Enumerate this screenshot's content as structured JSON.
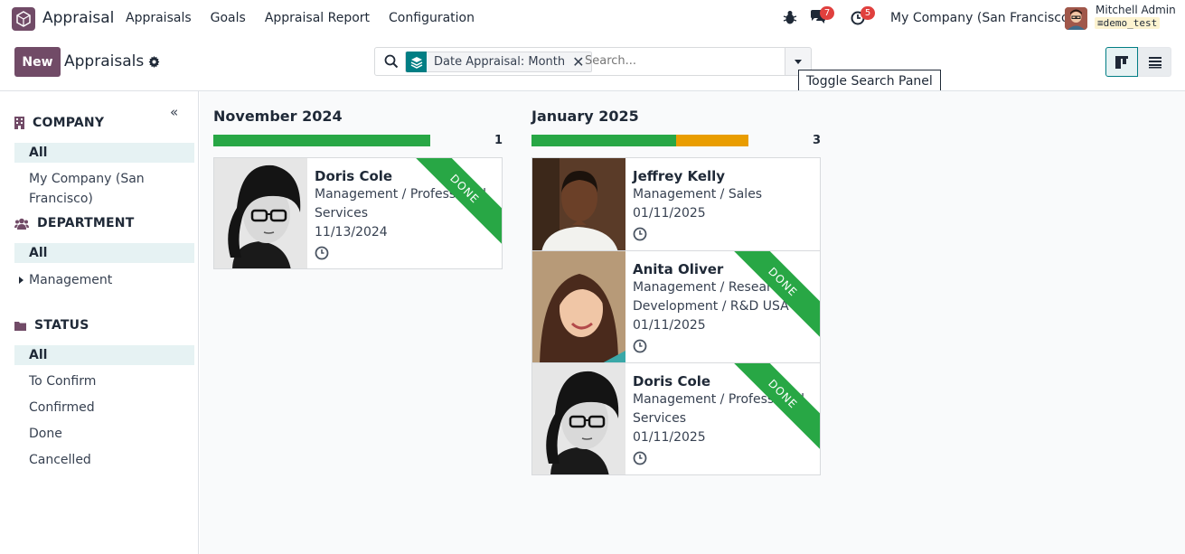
{
  "navbar": {
    "app_name": "Appraisal",
    "menu": [
      "Appraisals",
      "Goals",
      "Appraisal Report",
      "Configuration"
    ],
    "chat_badge": "7",
    "activity_badge": "5",
    "company": "My Company (San Francisco)",
    "user_name": "Mitchell Admin",
    "database": "demo_test"
  },
  "control_panel": {
    "new_label": "New",
    "breadcrumb": "Appraisals",
    "facet_label": "Date Appraisal: Month",
    "search_placeholder": "Search...",
    "tooltip": "Toggle Search Panel"
  },
  "sidepanel": {
    "sections": [
      {
        "title": "COMPANY",
        "icon": "building-icon",
        "items": [
          "All",
          "My Company (San Francisco)"
        ]
      },
      {
        "title": "DEPARTMENT",
        "icon": "users-icon",
        "items": [
          "All",
          "Management"
        ]
      },
      {
        "title": "STATUS",
        "icon": "folder-icon",
        "items": [
          "All",
          "To Confirm",
          "Confirmed",
          "Done",
          "Cancelled"
        ]
      }
    ]
  },
  "kanban": {
    "columns": [
      {
        "title": "November 2024",
        "count": "1",
        "progress": {
          "green": 1.0,
          "orange": 0.0
        },
        "cards": [
          {
            "name": "Doris Cole",
            "lines": [
              "Management / Professional",
              "Services"
            ],
            "date": "11/13/2024",
            "ribbon": "DONE",
            "photo": "woman-beanie-glasses"
          }
        ]
      },
      {
        "title": "January 2025",
        "count": "3",
        "progress": {
          "green": 0.667,
          "orange": 0.333
        },
        "cards": [
          {
            "name": "Jeffrey Kelly",
            "lines": [
              "Management / Sales"
            ],
            "date": "01/11/2025",
            "ribbon": "",
            "photo": "man-white-shirt"
          },
          {
            "name": "Anita Oliver",
            "lines": [
              "Management / Research &",
              "Development / R&D USA"
            ],
            "date": "01/11/2025",
            "ribbon": "DONE",
            "photo": "woman-smiling"
          },
          {
            "name": "Doris Cole",
            "lines": [
              "Management / Professional",
              "Services"
            ],
            "date": "01/11/2025",
            "ribbon": "DONE",
            "photo": "woman-beanie-glasses"
          }
        ]
      }
    ]
  },
  "colors": {
    "brand": "#714B67",
    "accent": "#017e84",
    "done": "#28a745",
    "warning": "#e99d00"
  }
}
